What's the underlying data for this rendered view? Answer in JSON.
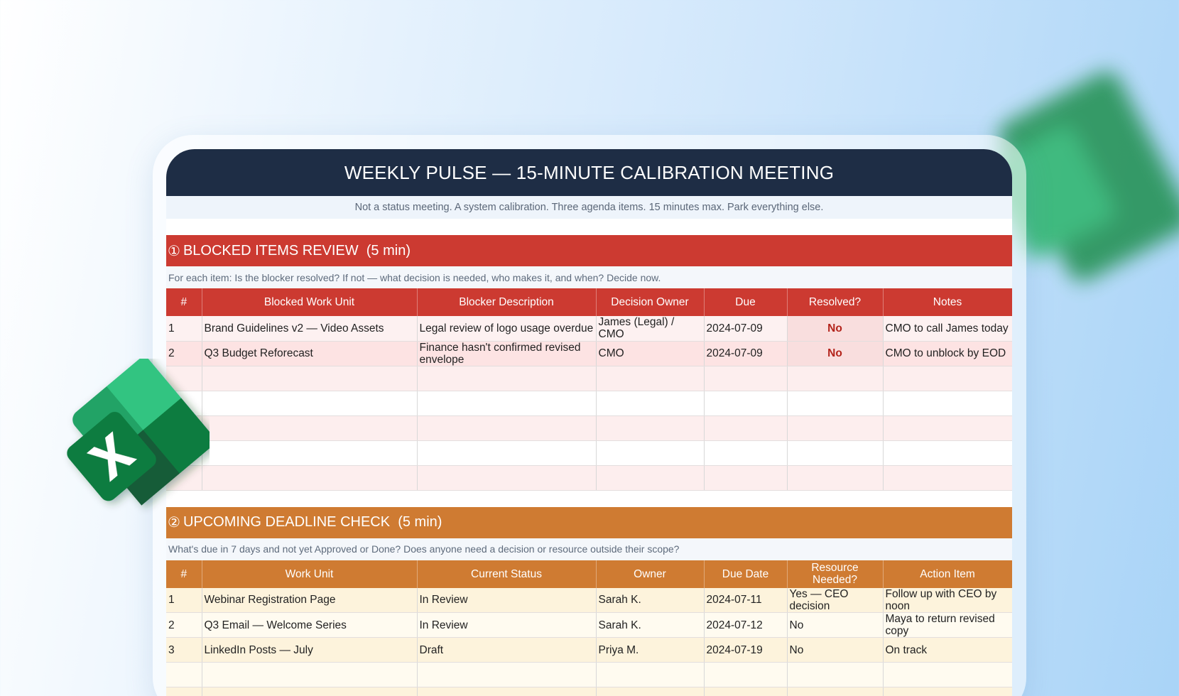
{
  "header": {
    "title": "WEEKLY PULSE — 15-MINUTE CALIBRATION MEETING",
    "subtitle": "Not a status meeting. A system calibration. Three agenda items. 15 minutes max. Park everything else."
  },
  "section1": {
    "badge": "①",
    "title": "BLOCKED ITEMS REVIEW  (5 min)",
    "instruction": "For each item: Is the blocker resolved? If not — what decision is needed, who makes it, and when? Decide now.",
    "columns": [
      "#",
      "Blocked Work Unit",
      "Blocker Description",
      "Decision Owner",
      "Due",
      "Resolved?",
      "Notes"
    ],
    "rows": [
      [
        "1",
        "Brand Guidelines v2 — Video Assets",
        "Legal review of logo usage overdue",
        "James (Legal) / CMO",
        "2024-07-09",
        "No",
        "CMO to call James today"
      ],
      [
        "2",
        "Q3 Budget Reforecast",
        "Finance hasn't confirmed revised envelope",
        "CMO",
        "2024-07-09",
        "No",
        "CMO to unblock by EOD"
      ]
    ]
  },
  "section2": {
    "badge": "②",
    "title": "UPCOMING DEADLINE CHECK  (5 min)",
    "instruction": "What's due in 7 days and not yet Approved or Done? Does anyone need a decision or resource outside their scope?",
    "columns": [
      "#",
      "Work Unit",
      "Current Status",
      "Owner",
      "Due Date",
      "Resource Needed?",
      "Action Item"
    ],
    "rows": [
      [
        "1",
        "Webinar Registration Page",
        "In Review",
        "Sarah K.",
        "2024-07-11",
        "Yes — CEO decision",
        "Follow up with CEO by noon"
      ],
      [
        "2",
        "Q3 Email — Welcome Series",
        "In Review",
        "Sarah K.",
        "2024-07-12",
        "No",
        "Maya to return revised copy"
      ],
      [
        "3",
        "LinkedIn Posts — July",
        "Draft",
        "Priya M.",
        "2024-07-19",
        "No",
        "On track"
      ]
    ]
  },
  "colors": {
    "title_bg": "#1e2d45",
    "section1_accent": "#cc3a31",
    "section2_accent": "#cf7b32",
    "resolved_no": "#b3231b"
  },
  "icons": {
    "logo": "excel-logo-icon"
  }
}
